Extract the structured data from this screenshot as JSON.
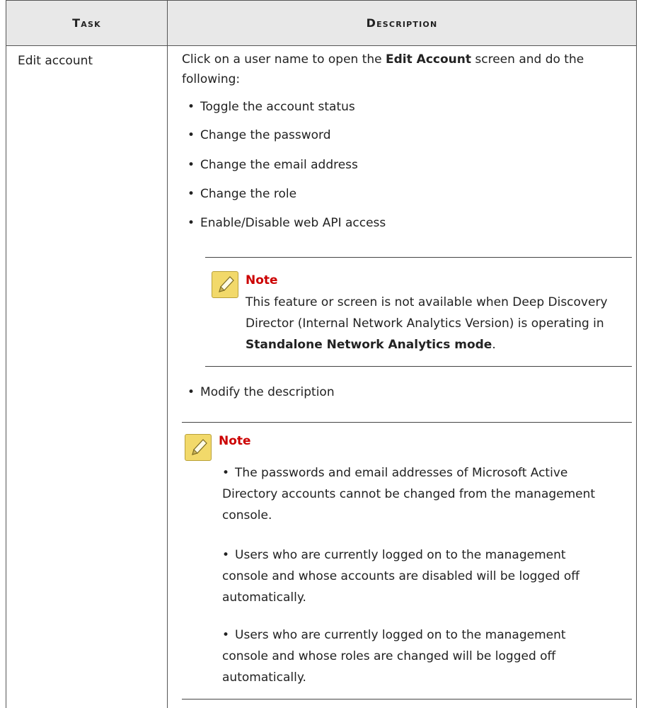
{
  "table": {
    "header": {
      "task": "Task",
      "description": "Description"
    },
    "row": {
      "task": "Edit account",
      "intro_prefix": "Click on a user name to open the ",
      "intro_bold": "Edit Account",
      "intro_suffix": " screen and do the following:",
      "bullets": [
        "Toggle the account status",
        "Change the password",
        "Change the email address",
        "Change the role",
        "Enable/Disable web API access"
      ],
      "inner_note": {
        "title": "Note",
        "text_prefix": "This feature or screen is not available when Deep Discovery Director (Internal Network Analytics Version) is operating in ",
        "text_bold": "Standalone Network Analytics mode",
        "text_suffix": "."
      },
      "after_bullet": "Modify the description",
      "outer_note": {
        "title": "Note",
        "bullets": [
          "The passwords and email addresses of Microsoft Active Directory accounts cannot be changed from the management console.",
          "Users who are currently logged on to the management console and whose accounts are disabled will be logged off automatically.",
          "Users who are currently logged on to the management console and whose roles are changed will be logged off automatically."
        ]
      }
    }
  },
  "colors": {
    "note_title": "#cc0000",
    "header_bg": "#e8e8e8",
    "note_icon": "#f2d96a"
  },
  "icons": {
    "note": "note-pencil-icon"
  }
}
